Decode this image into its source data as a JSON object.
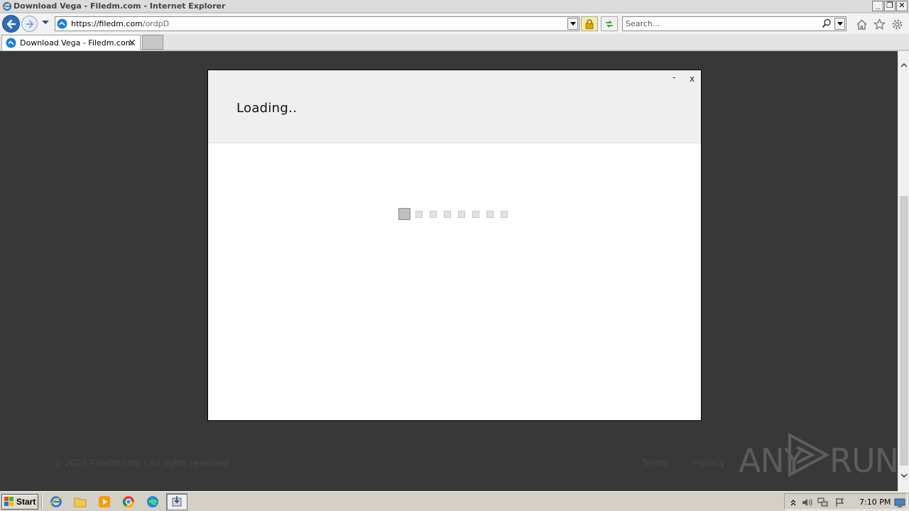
{
  "window": {
    "title": "Download Vega - Filedm.com - Internet Explorer",
    "minimize": "_",
    "restore": "❐",
    "close": "✕"
  },
  "address_bar": {
    "url_host": "https://filedm.com",
    "url_path": "/ordpD"
  },
  "search": {
    "placeholder": "Search..."
  },
  "tab": {
    "title": "Download Vega - Filedm.com",
    "close": "✕"
  },
  "modal": {
    "title": "Loading..",
    "minimize": "-",
    "close": "x",
    "loader_squares": 8,
    "loader_active_index": 0
  },
  "footer": {
    "copyright": "© 2023 Filedm.com - All rights reserved",
    "links": [
      "Terms",
      "Privacy"
    ]
  },
  "watermark": {
    "left": "ANY",
    "right": "RUN"
  },
  "taskbar": {
    "start_label": "Start",
    "clock": "7:10 PM"
  },
  "colors": {
    "page_bg": "#383838",
    "modal_header_bg": "#efefef",
    "ie_blue": "#2d6fb7"
  }
}
